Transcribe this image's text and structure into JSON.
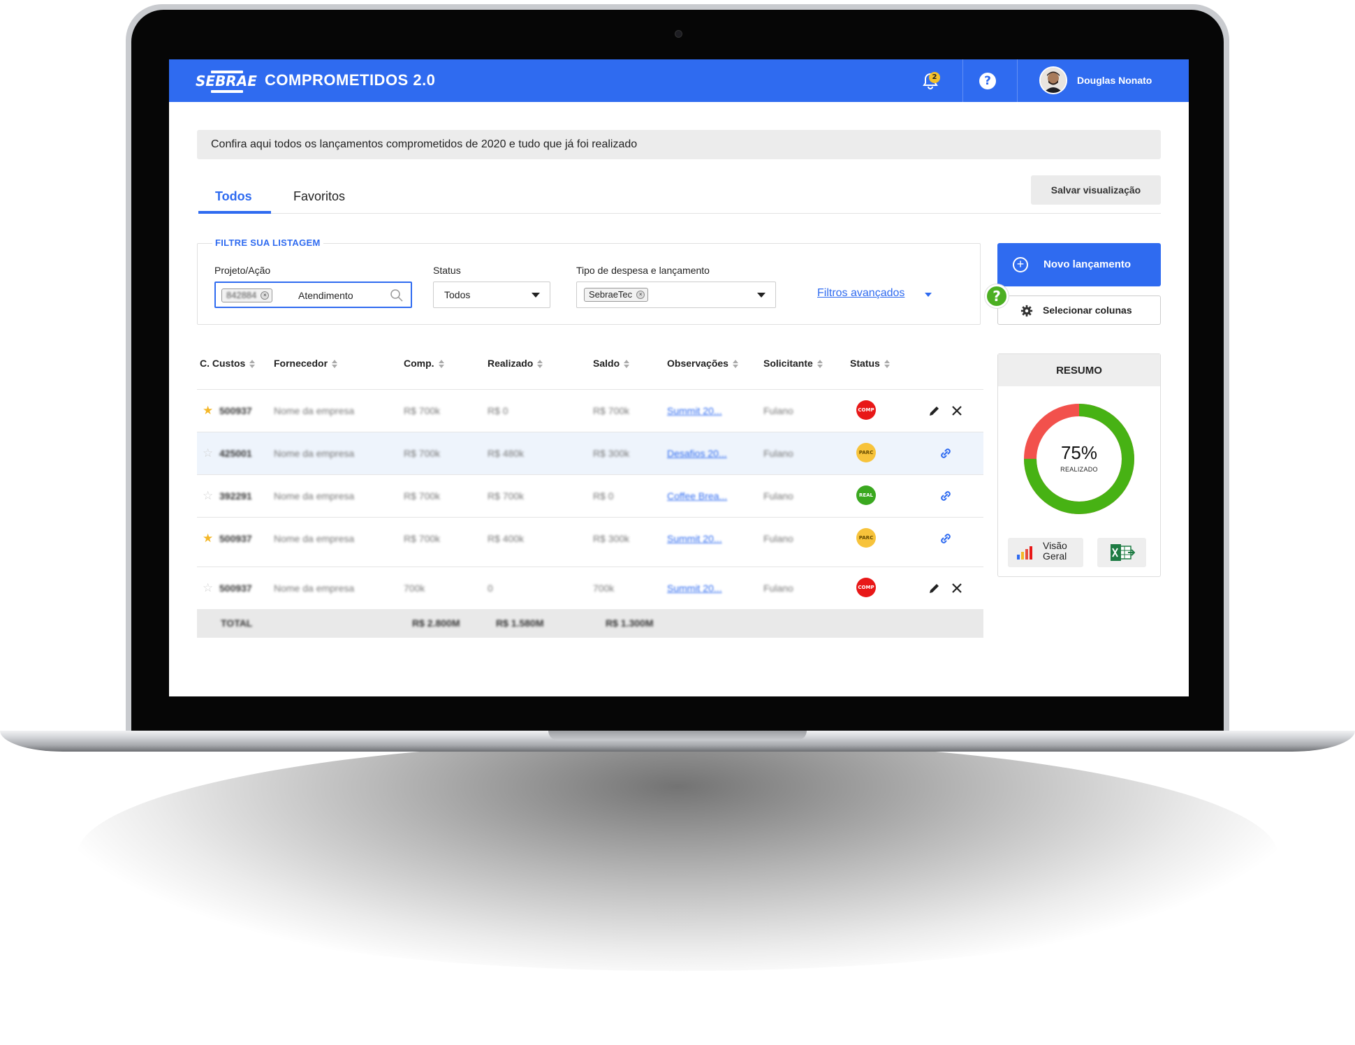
{
  "header": {
    "logo_text": "SEBRAE",
    "title": "COMPROMETIDOS 2.0",
    "notification_count": "2",
    "help_symbol": "?",
    "user_name": "Douglas Nonato",
    "brand_color": "#2f6bf0"
  },
  "banner": "Confira aqui todos os lançamentos comprometidos de 2020 e tudo que já foi realizado",
  "tabs": [
    {
      "label": "Todos",
      "active": true
    },
    {
      "label": "Favoritos",
      "active": false
    }
  ],
  "save_view_label": "Salvar visualização",
  "filters": {
    "title": "FILTRE SUA LISTAGEM",
    "projeto": {
      "label": "Projeto/Ação",
      "chip": "842884",
      "value": "Atendimento"
    },
    "status": {
      "label": "Status",
      "value": "Todos"
    },
    "tipo": {
      "label": "Tipo de despesa e lançamento",
      "chip": "SebraeTec"
    },
    "advanced_label": "Filtros avançados"
  },
  "actions": {
    "new_entry": "Novo lançamento",
    "select_columns": "Selecionar colunas",
    "help_symbol": "?"
  },
  "table": {
    "columns": [
      "C. Custos",
      "Fornecedor",
      "Comp.",
      "Realizado",
      "Saldo",
      "Observações",
      "Solicitante",
      "Status"
    ],
    "rows": [
      {
        "favorite": true,
        "c_custos": "500937",
        "fornecedor": "Nome da empresa",
        "comp": "R$ 700k",
        "realizado": "R$ 0",
        "saldo": "R$ 700k",
        "obs": "Summit 20...",
        "solicitante": "Fulano",
        "status": "COMP",
        "actions": "edit-delete"
      },
      {
        "favorite": false,
        "c_custos": "425001",
        "fornecedor": "Nome da empresa",
        "comp": "R$ 700k",
        "realizado": "R$ 480k",
        "saldo": "R$ 300k",
        "obs": "Desafios 20...",
        "solicitante": "Fulano",
        "status": "PARC",
        "actions": "link"
      },
      {
        "favorite": false,
        "c_custos": "392291",
        "fornecedor": "Nome da empresa",
        "comp": "R$ 700k",
        "realizado": "R$ 700k",
        "saldo": "R$ 0",
        "obs": "Coffee Brea...",
        "solicitante": "Fulano",
        "status": "REAL",
        "actions": "link"
      },
      {
        "favorite": true,
        "c_custos": "500937",
        "fornecedor": "Nome da empresa",
        "comp": "R$ 700k",
        "realizado": "R$ 400k",
        "saldo": "R$ 300k",
        "obs": "Summit 20...",
        "solicitante": "Fulano",
        "status": "PARC",
        "actions": "link"
      },
      {
        "favorite": false,
        "c_custos": "500937",
        "fornecedor": "Nome da empresa",
        "comp": "700k",
        "realizado": "0",
        "saldo": "700k",
        "obs": "Summit 20...",
        "solicitante": "Fulano",
        "status": "COMP",
        "actions": "edit-delete"
      }
    ],
    "total": {
      "label": "TOTAL",
      "comp": "R$ 2.800M",
      "realizado": "R$ 1.580M",
      "saldo": "R$ 1.300M"
    }
  },
  "resumo": {
    "title": "RESUMO",
    "percent": "75%",
    "percent_value": 75,
    "percent_label": "REALIZADO",
    "colors": {
      "realizado": "#47b214",
      "restante": "#f2514c"
    },
    "visao_geral_line1": "Visão",
    "visao_geral_line2": "Geral"
  }
}
